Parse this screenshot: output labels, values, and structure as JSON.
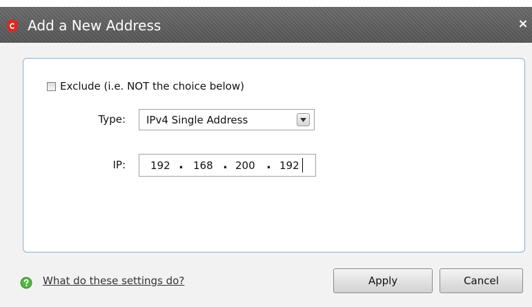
{
  "window": {
    "title": "Add a New Address",
    "close_glyph": "×",
    "logo_icon": "comodo-c-shield-icon",
    "logo_color": "#d62b26"
  },
  "form": {
    "exclude_checkbox": {
      "label": "Exclude (i.e. NOT the choice below)",
      "checked": false
    },
    "type": {
      "label": "Type:",
      "selected": "IPv4 Single Address"
    },
    "ip": {
      "label": "IP:",
      "octets": [
        "192",
        "168",
        "200",
        "192"
      ],
      "separator": "."
    }
  },
  "footer": {
    "help_icon": "question-mark-green-icon",
    "help_link": "What do these settings do?",
    "apply_label": "Apply",
    "cancel_label": "Cancel"
  }
}
